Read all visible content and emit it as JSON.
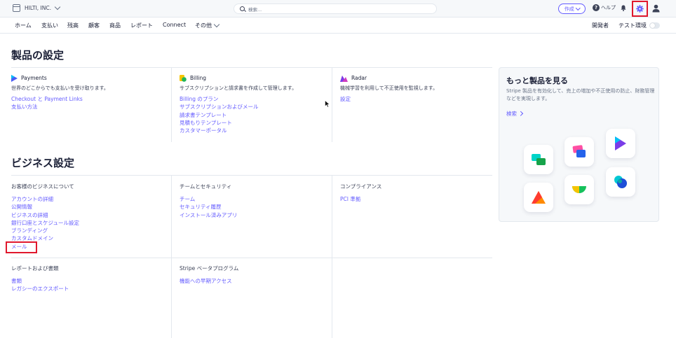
{
  "topbar": {
    "account_name": "HILTI, INC.",
    "search_placeholder": "検索...",
    "create_label": "作成",
    "help_label": "ヘルプ"
  },
  "nav": {
    "items": [
      "ホーム",
      "支払い",
      "残高",
      "顧客",
      "商品",
      "レポート",
      "Connect",
      "その他"
    ],
    "developers_label": "開発者",
    "test_mode_label": "テスト環境"
  },
  "products_section": {
    "title": "製品の設定",
    "columns": [
      {
        "name": "Payments",
        "description": "世界のどこからでも支払いを受け取ります。",
        "links": [
          "Checkout と Payment Links",
          "支払い方法"
        ]
      },
      {
        "name": "Billing",
        "description": "サブスクリプションと請求書を作成して管理します。",
        "links": [
          "Billing のプラン",
          "サブスクリプションおよびメール",
          "請求書テンプレート",
          "見積もりテンプレート",
          "カスタマーポータル"
        ]
      },
      {
        "name": "Radar",
        "description": "機械学習を利用して不正使用を監視します。",
        "links": [
          "設定"
        ]
      }
    ]
  },
  "business_section": {
    "title": "ビジネス設定",
    "groups": [
      {
        "heading": "お客様のビジネスについて",
        "links": [
          "アカウントの詳細",
          "公開情報",
          "ビジネスの詳細",
          "銀行口座とスケジュール設定",
          "ブランディング",
          "カスタムドメイン",
          "メール"
        ]
      },
      {
        "heading": "チームとセキュリティ",
        "links": [
          "チーム",
          "セキュリティ履歴",
          "インストール済みアプリ"
        ]
      },
      {
        "heading": "コンプライアンス",
        "links": [
          "PCI 準拠"
        ]
      },
      {
        "heading": "レポートおよび書類",
        "links": [
          "書類",
          "レガシーのエクスポート"
        ]
      },
      {
        "heading": "Stripe ベータプログラム",
        "links": [
          "機能への早期アクセス"
        ]
      }
    ]
  },
  "more_products_card": {
    "title": "もっと製品を見る",
    "description": "Stripe 製品を有効化して、売上の増加や不正使用の防止、財務管理などを実現します。",
    "link_label": "検索"
  },
  "colors": {
    "accent": "#635bff",
    "highlight_red": "#e0182d",
    "text_primary": "#1a1f36",
    "text_secondary": "#3c4257",
    "topbar_bg": "#f6f8fa"
  }
}
